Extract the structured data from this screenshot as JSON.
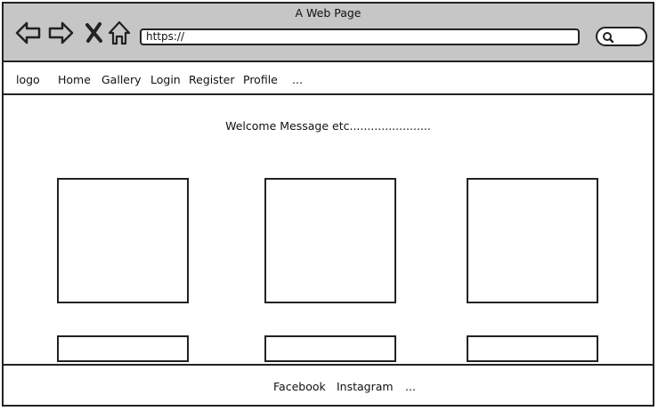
{
  "window": {
    "title": "A Web Page"
  },
  "browser": {
    "url": "https://",
    "icons": [
      "back-arrow-icon",
      "forward-arrow-icon",
      "close-x-icon",
      "home-icon",
      "search-icon"
    ]
  },
  "navbar": {
    "logo": "logo",
    "items": [
      "Home",
      "Gallery",
      "Login",
      "Register",
      "Profile",
      "..."
    ]
  },
  "main": {
    "welcome": "Welcome Message etc.......................",
    "cards": [
      {
        "caption": ""
      },
      {
        "caption": ""
      },
      {
        "caption": ""
      }
    ]
  },
  "footer": {
    "links": [
      "Facebook",
      "Instagram",
      "..."
    ]
  }
}
